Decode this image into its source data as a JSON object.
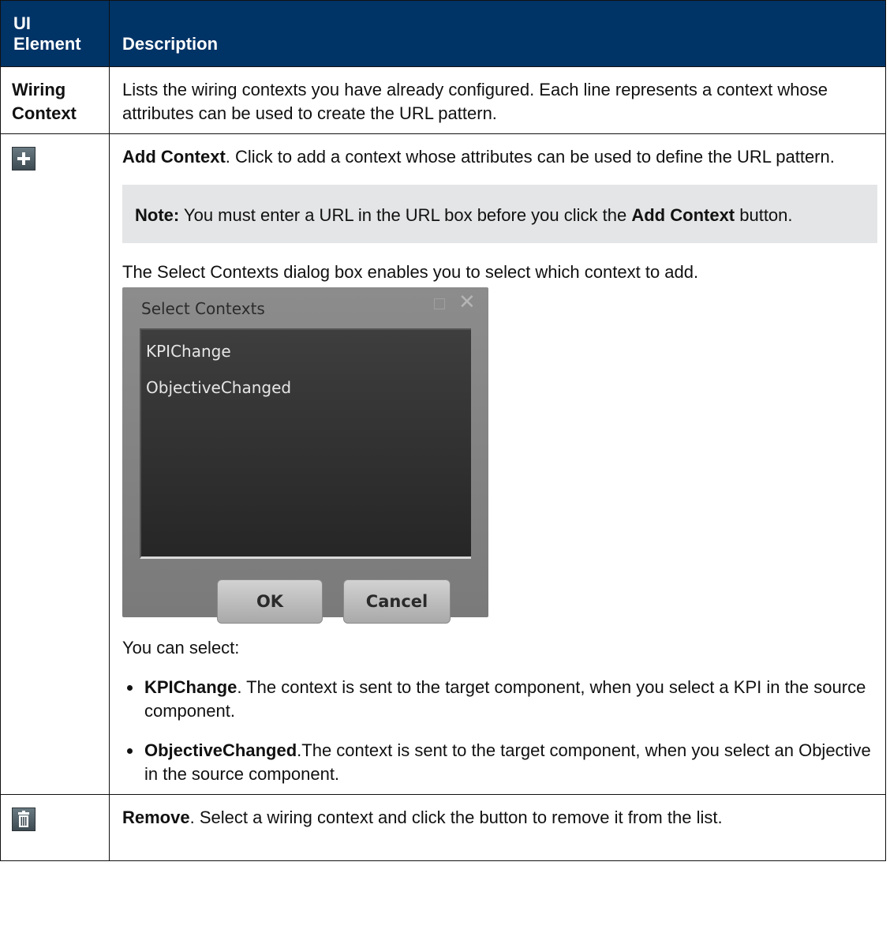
{
  "header": {
    "col1": "UI Element",
    "col2": "Description"
  },
  "rows": {
    "wiring": {
      "element": "Wiring Context",
      "description": "Lists the wiring contexts you have already configured. Each line represents a context whose attributes can be used to create the URL pattern."
    },
    "add": {
      "icon": "plus-icon",
      "title": "Add Context",
      "text": ". Click to add a context whose attributes can be used to define the URL pattern.",
      "note_label": "Note:",
      "note_text1": " You must enter a URL in the URL box before you click the ",
      "note_bold": "Add Context",
      "note_text2": " button.",
      "dialog_intro": "The Select Contexts dialog box enables you to select which context to add.",
      "dialog": {
        "title": "Select Contexts",
        "items": [
          "KPIChange",
          "ObjectiveChanged"
        ],
        "ok": "OK",
        "cancel": "Cancel"
      },
      "select_intro": "You can select:",
      "options": [
        {
          "name": "KPIChange",
          "text": ". The context is sent to the target component, when you select a KPI in the source component."
        },
        {
          "name": "ObjectiveChanged",
          "text": ".The context is sent to the target component, when you select an Objective in the source component."
        }
      ]
    },
    "remove": {
      "icon": "trash-icon",
      "title": "Remove",
      "text": ". Select a wiring context and click the button to remove it from the list."
    }
  },
  "colors": {
    "header_bg": "#003366",
    "note_bg": "#e4e5e6"
  }
}
